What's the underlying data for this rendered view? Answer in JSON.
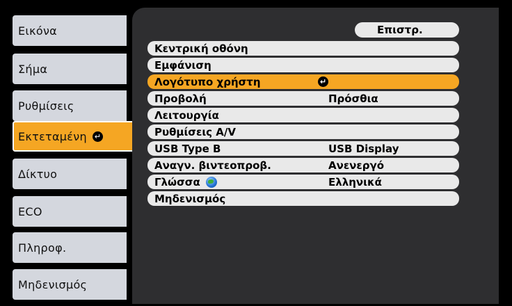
{
  "sidebar": {
    "items": [
      {
        "label": "Εικόνα"
      },
      {
        "label": "Σήμα"
      },
      {
        "label": "Ρυθμίσεις"
      },
      {
        "label": "Εκτεταμένη"
      },
      {
        "label": "Δίκτυο"
      },
      {
        "label": "ECO"
      },
      {
        "label": "Πληροφ."
      },
      {
        "label": "Μηδενισμός"
      }
    ]
  },
  "panel": {
    "back_label": "Επιστρ.",
    "rows": [
      {
        "label": "Κεντρική οθόνη",
        "value": ""
      },
      {
        "label": "Εμφάνιση",
        "value": ""
      },
      {
        "label": "Λογότυπο χρήστη",
        "value": ""
      },
      {
        "label": "Προβολή",
        "value": "Πρόσθια"
      },
      {
        "label": "Λειτουργία",
        "value": ""
      },
      {
        "label": "Ρυθμίσεις A/V",
        "value": ""
      },
      {
        "label": "USB Type B",
        "value": "USB Display"
      },
      {
        "label": "Αναγν. βιντεοπροβ.",
        "value": "Ανενεργό"
      },
      {
        "label": "Γλώσσα",
        "value": "Ελληνικά"
      },
      {
        "label": "Μηδενισμός",
        "value": ""
      }
    ]
  },
  "colors": {
    "accent": "#f5a623",
    "menu_bg": "#2e2e30",
    "item_bg": "#d4d7de"
  }
}
